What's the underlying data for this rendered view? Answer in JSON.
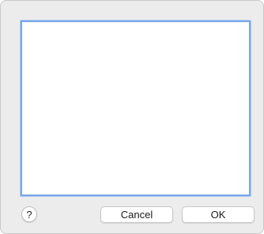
{
  "dialog": {
    "help_label": "?",
    "cancel_label": "Cancel",
    "ok_label": "OK"
  },
  "colors": {
    "dialog_background": "#ececec",
    "focus_ring": "#7aa6e6",
    "list_background": "#ffffff"
  },
  "icons": {
    "help": "help-icon"
  }
}
